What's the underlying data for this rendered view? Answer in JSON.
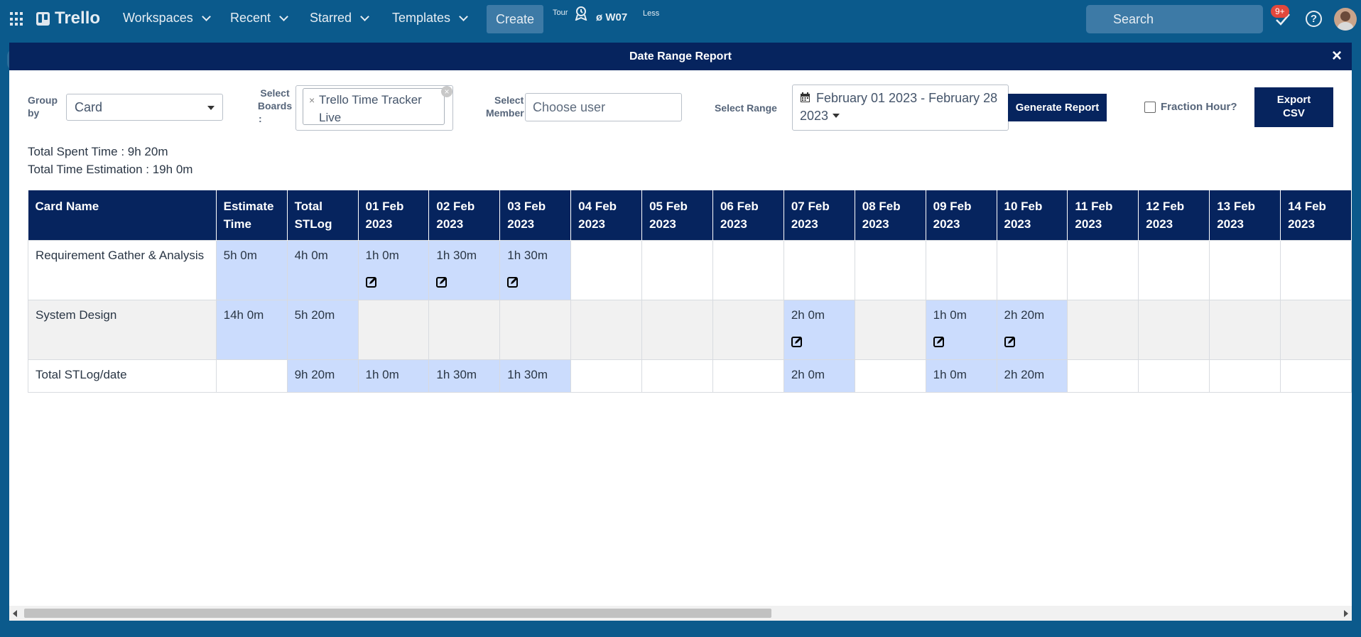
{
  "topbar": {
    "logo": "Trello",
    "nav": [
      "Workspaces",
      "Recent",
      "Starred",
      "Templates"
    ],
    "create": "Create",
    "tour": "Tour",
    "w07": "ø  W07",
    "less": "Less",
    "search_placeholder": "Search",
    "notifications_badge": "9+",
    "help": "?"
  },
  "modal": {
    "title": "Date Range Report",
    "close": "×",
    "group_by_label_1": "Group",
    "group_by_label_2": "by",
    "group_by_value": "Card",
    "boards_label_1": "Select",
    "boards_label_2": "Boards",
    "boards_label_3": ":",
    "board_chip_1": "Trello Time Tracker",
    "board_chip_2": "Live",
    "member_label_1": "Select",
    "member_label_2": "Member",
    "member_placeholder": "Choose user",
    "range_label": "Select Range",
    "range_value_1": "February 01 2023 - February 28",
    "range_value_2": "2023",
    "generate_button": "Generate Report",
    "fraction_label": "Fraction Hour?",
    "export_line_1": "Export",
    "export_line_2": "CSV",
    "total_spent": "Total Spent Time : 9h 20m",
    "total_estimation": "Total Time Estimation : 19h 0m"
  },
  "table": {
    "headers": [
      [
        "Card Name",
        ""
      ],
      [
        "Estimate",
        "Time"
      ],
      [
        "Total",
        "STLog"
      ],
      [
        "01 Feb",
        "2023"
      ],
      [
        "02 Feb",
        "2023"
      ],
      [
        "03 Feb",
        "2023"
      ],
      [
        "04 Feb",
        "2023"
      ],
      [
        "05 Feb",
        "2023"
      ],
      [
        "06 Feb",
        "2023"
      ],
      [
        "07 Feb",
        "2023"
      ],
      [
        "08 Feb",
        "2023"
      ],
      [
        "09 Feb",
        "2023"
      ],
      [
        "10 Feb",
        "2023"
      ],
      [
        "11 Feb",
        "2023"
      ],
      [
        "12 Feb",
        "2023"
      ],
      [
        "13 Feb",
        "2023"
      ],
      [
        "14 Feb",
        "2023"
      ]
    ],
    "rows": [
      {
        "cells": [
          "Requirement Gather & Analysis",
          "5h 0m",
          "4h 0m",
          "1h 0m",
          "1h 30m",
          "1h 30m",
          "",
          "",
          "",
          "",
          "",
          "",
          "",
          "",
          "",
          "",
          ""
        ],
        "highlight": [
          false,
          true,
          true,
          true,
          true,
          true,
          false,
          false,
          false,
          false,
          false,
          false,
          false,
          false,
          false,
          false,
          false
        ],
        "edit": [
          false,
          false,
          false,
          true,
          true,
          true,
          false,
          false,
          false,
          false,
          false,
          false,
          false,
          false,
          false,
          false,
          false
        ]
      },
      {
        "cells": [
          "System Design",
          "14h 0m",
          "5h 20m",
          "",
          "",
          "",
          "",
          "",
          "",
          "2h 0m",
          "",
          "1h 0m",
          "2h 20m",
          "",
          "",
          "",
          ""
        ],
        "highlight": [
          false,
          true,
          true,
          false,
          false,
          false,
          false,
          false,
          false,
          true,
          false,
          true,
          true,
          false,
          false,
          false,
          false
        ],
        "edit": [
          false,
          false,
          false,
          false,
          false,
          false,
          false,
          false,
          false,
          true,
          false,
          true,
          true,
          false,
          false,
          false,
          false
        ]
      },
      {
        "cells": [
          "Total STLog/date",
          "",
          "9h 20m",
          "1h 0m",
          "1h 30m",
          "1h 30m",
          "",
          "",
          "",
          "2h 0m",
          "",
          "1h 0m",
          "2h 20m",
          "",
          "",
          "",
          ""
        ],
        "highlight": [
          false,
          false,
          true,
          true,
          true,
          true,
          false,
          false,
          false,
          true,
          false,
          true,
          true,
          false,
          false,
          false,
          false
        ],
        "edit": [
          false,
          false,
          false,
          false,
          false,
          false,
          false,
          false,
          false,
          false,
          false,
          false,
          false,
          false,
          false,
          false,
          false
        ]
      }
    ]
  }
}
